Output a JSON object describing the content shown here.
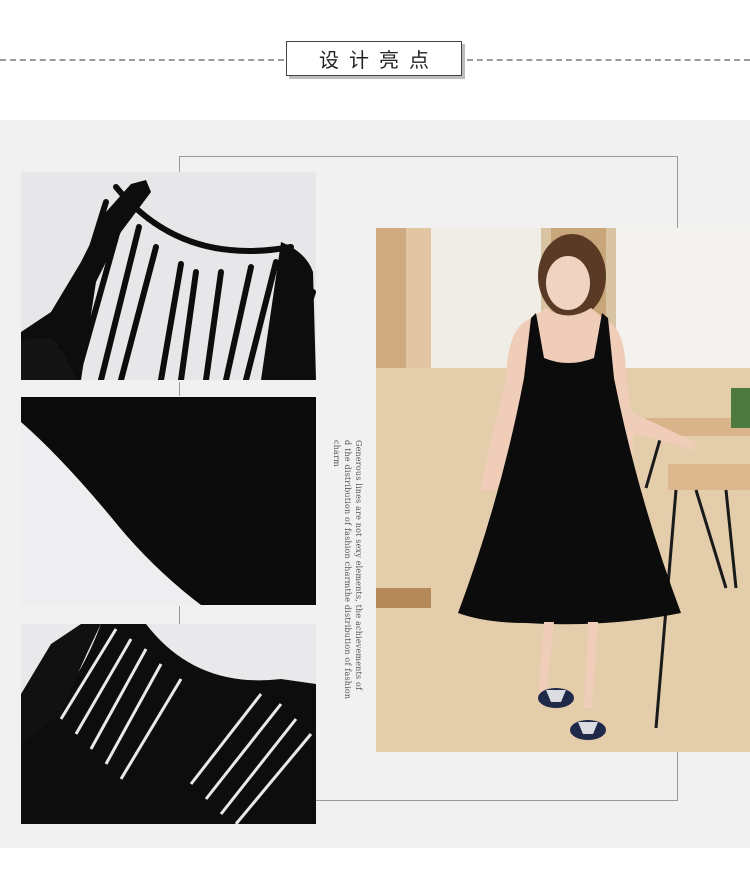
{
  "header": {
    "title": "设计亮点"
  },
  "caption": {
    "lines": [
      "Generous lines are not sexy elements, the achievements of",
      "d the distribution of fashion charmthe distribution of fashion charm"
    ]
  },
  "colors": {
    "panel_background": "#f1f1f1",
    "dress": "#0c0c0c",
    "frame_line": "#9a9a9a"
  }
}
